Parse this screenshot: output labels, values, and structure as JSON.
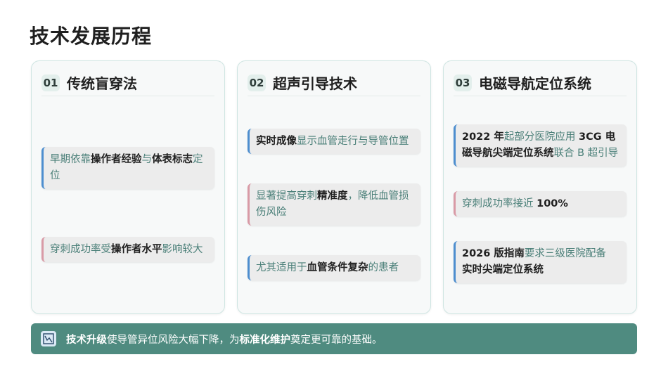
{
  "page": {
    "title": "技术发展历程"
  },
  "cards": [
    {
      "num": "01",
      "title": "传统盲穿法",
      "items": [
        {
          "parts": [
            "早期依靠",
            "操作者经验",
            "与",
            "体表标志",
            "定位"
          ]
        },
        {
          "parts": [
            "穿刺成功率受",
            "操作者水平",
            "影响较大"
          ]
        }
      ]
    },
    {
      "num": "02",
      "title": "超声引导技术",
      "items": [
        {
          "parts": [
            "实时成像",
            "显示血管走行与导管位置"
          ]
        },
        {
          "parts": [
            "显著提高穿刺",
            "精准度",
            "，降低血管损伤风险"
          ]
        },
        {
          "parts": [
            "尤其适用于",
            "血管条件复杂",
            "的患者"
          ]
        }
      ]
    },
    {
      "num": "03",
      "title": "电磁导航定位系统",
      "items": [
        {
          "parts": [
            "2022 年",
            "起部分医院应用 ",
            "3CG 电磁导航尖端定位系统",
            "联合 B 超引导"
          ]
        },
        {
          "parts": [
            "穿刺成功率接近 ",
            "100%"
          ]
        },
        {
          "parts": [
            "2026 版指南",
            "要求三级医院配备",
            "实时尖端定位系统"
          ]
        }
      ]
    }
  ],
  "footer": {
    "icon": "chart-icon",
    "parts": [
      "技术升级",
      "使导管异位风险大幅下降，为",
      "标准化维护",
      "奠定更可靠的基础。"
    ]
  },
  "colors": {
    "accent": "#4f8b80",
    "blue_bar": "#4d8ecf",
    "pink_bar": "#d99aa6",
    "teal_text": "#4a7f78"
  }
}
